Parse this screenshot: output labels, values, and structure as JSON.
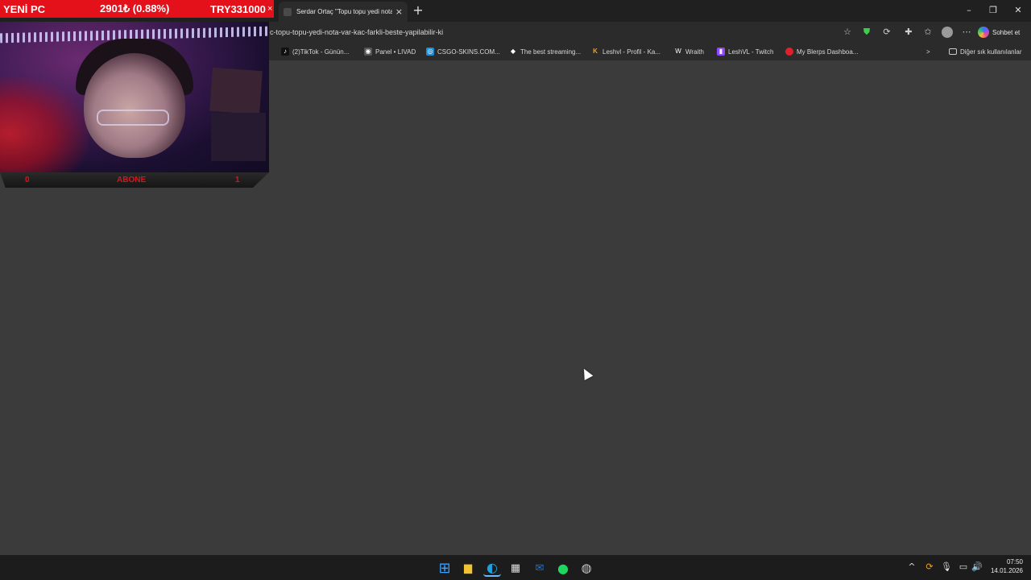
{
  "browser": {
    "tab_title": "Serdar Ortaç \"Topu topu yedi nota",
    "tab_close": "×",
    "new_tab": "+",
    "address": "c-topu-topu-yedi-nota-var-kac-farkli-beste-yapilabilir-ki",
    "copilot_label": "Sohbet et",
    "window_controls": {
      "minimize": "–",
      "restore": "❐",
      "close": "✕"
    },
    "bookmarks": [
      {
        "label": "(2)TikTok - Günün...",
        "icon": "tiktok-icon",
        "color": "#111111",
        "glyph": "♪"
      },
      {
        "label": "Panel • LIVAD",
        "icon": "panel-icon",
        "color": "#666666",
        "glyph": "◉"
      },
      {
        "label": "CSGO-SKINS.COM...",
        "icon": "csgo-icon",
        "color": "#1e8ed8",
        "glyph": "◎"
      },
      {
        "label": "The best streaming...",
        "icon": "streaming-icon",
        "color": "#ffffff",
        "glyph": "◆"
      },
      {
        "label": "Leshvl - Profil - Ka...",
        "icon": "kick-icon",
        "color": "#f0a020",
        "glyph": "K"
      },
      {
        "label": "Wraith",
        "icon": "wraith-icon",
        "color": "#444444",
        "glyph": "W"
      },
      {
        "label": "LeshVL - Twitch",
        "icon": "twitch-icon",
        "color": "#9146ff",
        "glyph": "▮"
      },
      {
        "label": "My Blerps Dashboa...",
        "icon": "blerp-icon",
        "color": "#e0202a",
        "glyph": "●"
      }
    ],
    "bookmarks_more": ">",
    "other_favorites": "Diğer sık kullanılanlar"
  },
  "overlay": {
    "ticker_title": "YENİ PC",
    "ticker_price": "2901₺ (0.88%)",
    "ticker_total": "TRY331000",
    "ticker_close": "×",
    "sub_left": "0",
    "sub_label": "ABONE",
    "sub_right": "1"
  },
  "taskbar": {
    "apps": [
      {
        "name": "windows-start-icon",
        "glyph": "⊞",
        "color": "#1e90ff"
      },
      {
        "name": "file-explorer-icon",
        "glyph": "▆",
        "color": "#f2c230"
      },
      {
        "name": "edge-icon",
        "glyph": "◐",
        "color": "#1fa0e0"
      },
      {
        "name": "microsoft-store-icon",
        "glyph": "▦",
        "color": "#dddddd"
      },
      {
        "name": "outlook-icon",
        "glyph": "✉",
        "color": "#1a73e8"
      },
      {
        "name": "spotify-icon",
        "glyph": "≋",
        "color": "#1ed760"
      },
      {
        "name": "obs-icon",
        "glyph": "◍",
        "color": "#cccccc"
      }
    ],
    "time": "07:50",
    "date": "14.01.2026"
  }
}
